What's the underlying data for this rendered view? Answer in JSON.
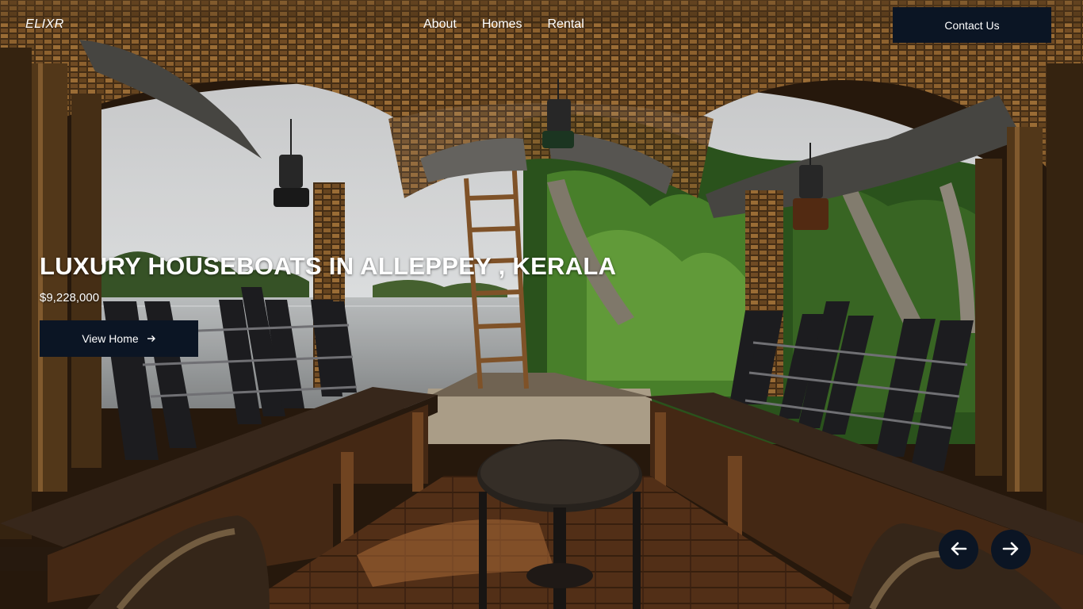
{
  "header": {
    "brand": "ELIXR",
    "nav": [
      {
        "label": "About"
      },
      {
        "label": "Homes"
      },
      {
        "label": "Rental"
      }
    ],
    "contact_label": "Contact Us"
  },
  "hero": {
    "title": "LUXURY HOUSEBOATS IN ALLEPPEY , KERALA",
    "price": "$9,228,000",
    "cta_label": "View Home",
    "cta_icon": "arrow-right-icon",
    "image_subject": "houseboat-interior-photo"
  },
  "carousel": {
    "prev_icon": "arrow-left-icon",
    "next_icon": "arrow-right-icon"
  },
  "colors": {
    "button_bg": "#0b1524",
    "text": "#ffffff"
  }
}
